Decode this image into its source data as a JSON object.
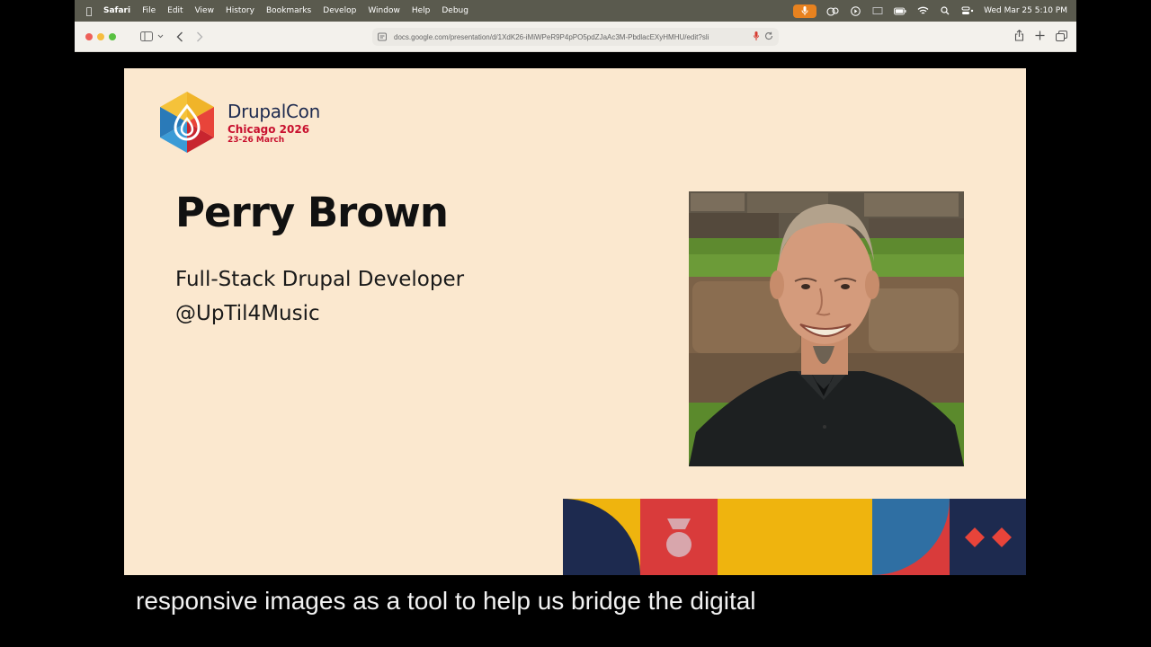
{
  "menubar": {
    "app": "Safari",
    "items": [
      "File",
      "Edit",
      "View",
      "History",
      "Bookmarks",
      "Develop",
      "Window",
      "Help",
      "Debug"
    ],
    "clock": "Wed Mar 25  5:10 PM"
  },
  "browser": {
    "url": "docs.google.com/presentation/d/1XdK26-iMiWPeR9P4pPO5pdZJaAc3M-PbdlacEXyHMHU/edit?sli"
  },
  "slide": {
    "logo": {
      "name": "DrupalCon",
      "city": "Chicago 2026",
      "dates": "23-26 March"
    },
    "speaker_name": "Perry Brown",
    "speaker_role": "Full-Stack Drupal Developer",
    "speaker_handle": "@UpTil4Music"
  },
  "caption": "responsive images as a tool to help us bridge the digital",
  "colors": {
    "slide_bg": "#fbe8cf",
    "navy": "#1d2a4f",
    "red": "#d93b3b",
    "yellow": "#efb40e",
    "blue": "#2f6fa3"
  }
}
